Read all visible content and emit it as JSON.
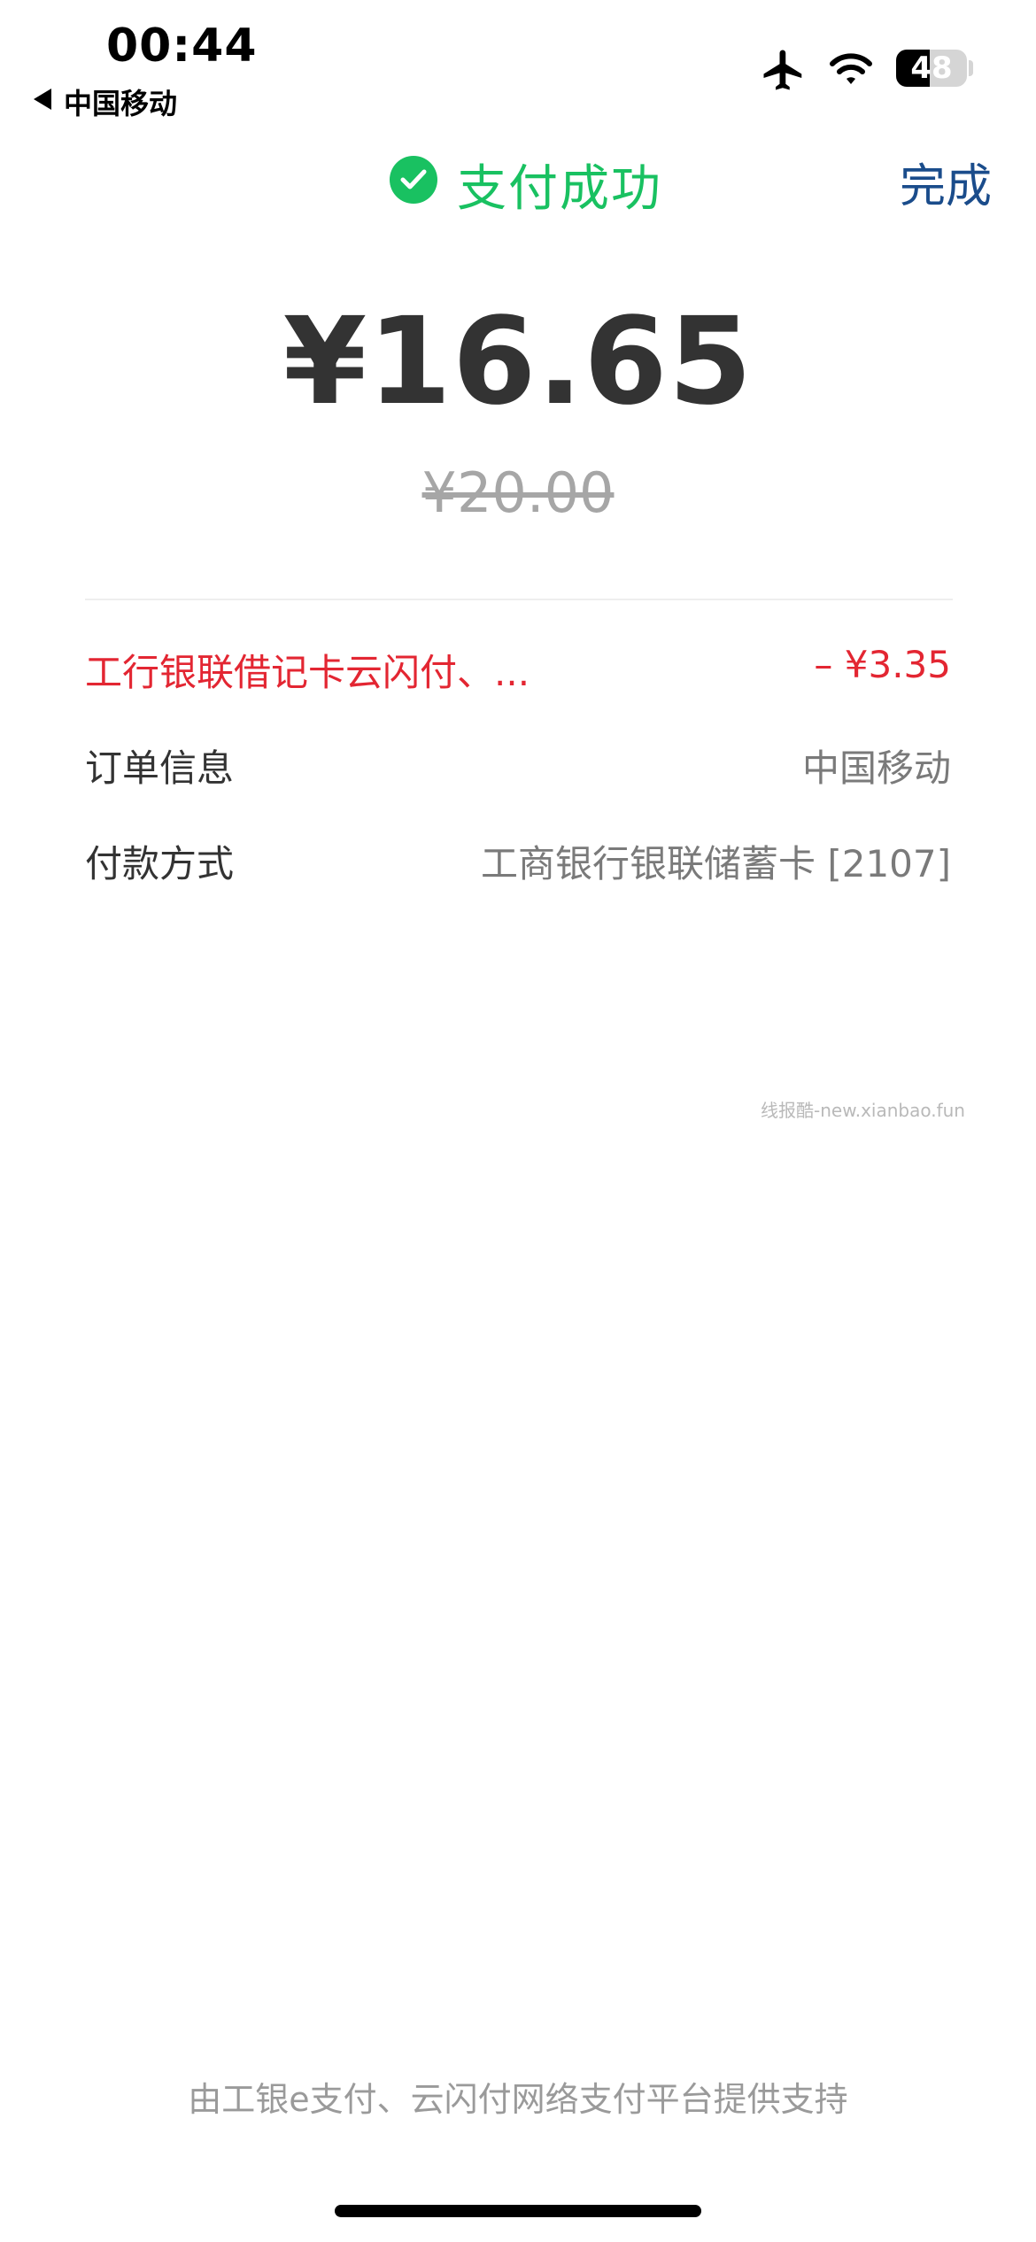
{
  "status_bar": {
    "time": "00:44",
    "back_label": "中国移动",
    "battery_level": "48",
    "battery_fraction": 0.48
  },
  "header": {
    "title": "支付成功",
    "done_label": "完成"
  },
  "amount": {
    "paid": "¥16.65",
    "original": "¥20.00"
  },
  "details": {
    "promo_label": "工行银联借记卡云闪付、...",
    "promo_value": "– ¥3.35",
    "order_label": "订单信息",
    "order_value": "中国移动",
    "payment_label": "付款方式",
    "payment_value": "工商银行银联储蓄卡 [2107]"
  },
  "watermark": "线报酷-new.xianbao.fun",
  "footer_text": "由工银e支付、云闪付网络支付平台提供支持",
  "colors": {
    "success_green": "#19c161",
    "done_blue": "#1a4c8b",
    "promo_red": "#e32632"
  },
  "icons": [
    "back-arrow-icon",
    "airplane-icon",
    "wifi-icon",
    "battery-icon",
    "check-circle-icon"
  ]
}
